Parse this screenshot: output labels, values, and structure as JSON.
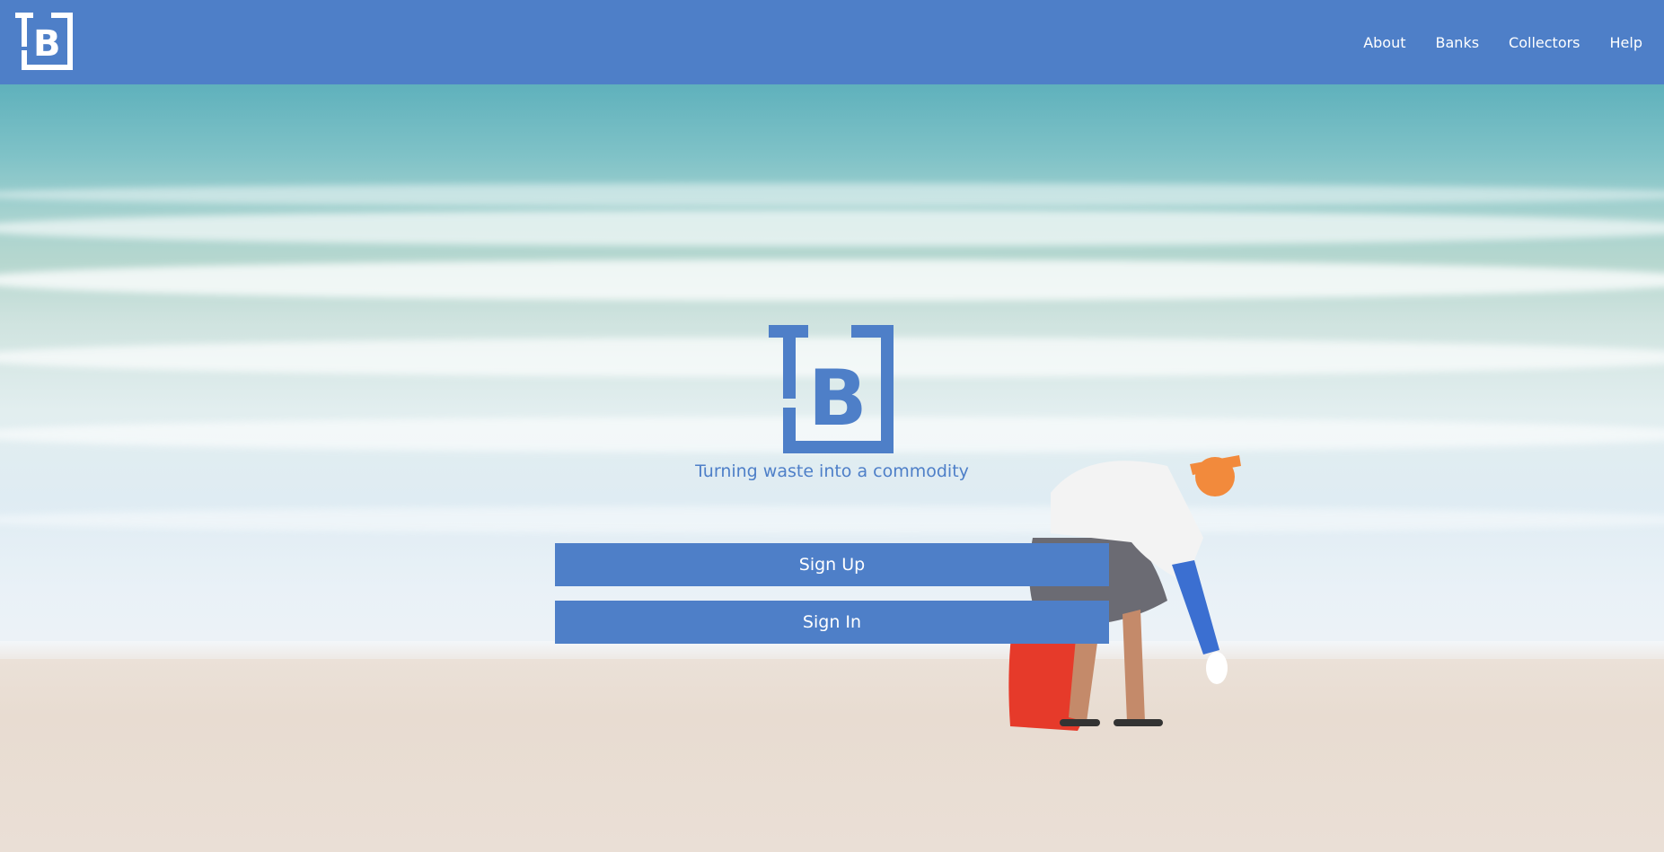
{
  "header": {
    "logo_icon": "tb-logo-icon",
    "nav": [
      {
        "label": "About"
      },
      {
        "label": "Banks"
      },
      {
        "label": "Collectors"
      },
      {
        "label": "Help"
      }
    ]
  },
  "hero": {
    "logo_icon": "tb-logo-icon",
    "tagline": "Turning waste into a commodity",
    "signup_label": "Sign Up",
    "signin_label": "Sign In"
  },
  "colors": {
    "brand": "#4e7fc8",
    "text_on_brand": "#ffffff"
  }
}
